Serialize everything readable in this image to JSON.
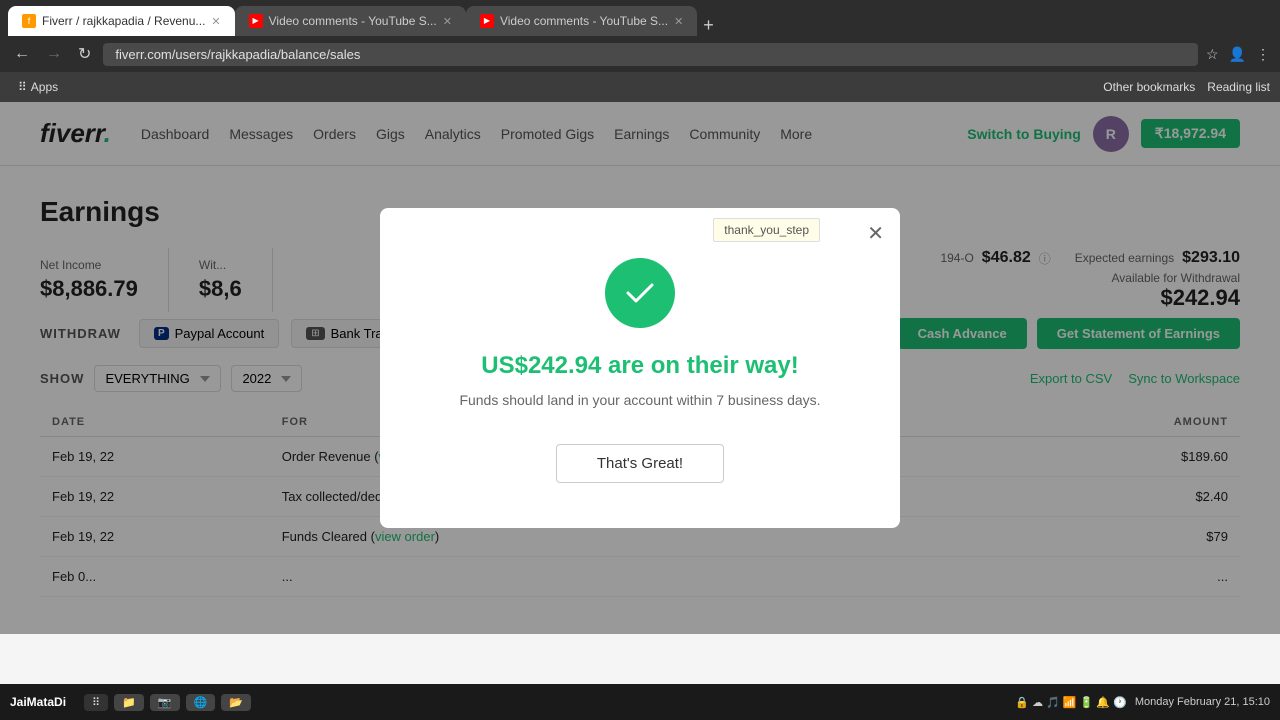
{
  "browser": {
    "tabs": [
      {
        "id": "tab1",
        "favicon_type": "fiverr",
        "label": "Fiverr / rajkkapadia / Revenu...",
        "active": true
      },
      {
        "id": "tab2",
        "favicon_type": "yt",
        "label": "Video comments - YouTube S...",
        "active": false
      },
      {
        "id": "tab3",
        "favicon_type": "yt",
        "label": "Video comments - YouTube S...",
        "active": false
      }
    ],
    "address": "fiverr.com/users/rajkkapadia/balance/sales",
    "bookmarks": [
      {
        "label": "Apps"
      }
    ],
    "bookmarks_right": [
      "Other bookmarks",
      "Reading list"
    ]
  },
  "fiverr_nav": {
    "logo": "fiverr",
    "logo_dot": ".",
    "links": [
      "Dashboard",
      "Messages",
      "Orders",
      "Gigs",
      "Analytics",
      "Promoted Gigs",
      "Earnings",
      "Community",
      "More"
    ],
    "switch_btn": "Switch to Buying",
    "balance": "₹18,972.94"
  },
  "earnings": {
    "title": "Earnings",
    "stats": {
      "net_income_label": "Net Income",
      "net_income_value": "$8,886.79",
      "withdrawn_label": "Wit...",
      "withdrawn_value": "$8,6",
      "available_label": "Available for Withdrawal",
      "available_value": "$242.94",
      "pending_label": "194-O",
      "pending_value": "$46.82",
      "expected_label": "Expected earnings",
      "expected_value": "$293.10"
    },
    "withdraw": {
      "label": "WITHDRAW",
      "paypal_label": "Paypal Account",
      "bank_label": "Bank Transfer",
      "cash_advance_label": "Cash Advance",
      "statement_label": "Get Statement of Earnings"
    },
    "show": {
      "label": "SHOW",
      "select_value": "EVERYTHING",
      "year_value": "2022",
      "export_csv": "Export to CSV",
      "sync_workspace": "Sync to Workspace"
    },
    "table": {
      "headers": [
        "DATE",
        "FOR",
        "AMOUNT"
      ],
      "rows": [
        {
          "date": "Feb 19, 22",
          "for": "Order Revenue (view order)",
          "amount": "$189.60",
          "positive": true
        },
        {
          "date": "Feb 19, 22",
          "for": "Tax collected/deducted at source (view order)",
          "amount": "$2.40",
          "positive": false
        },
        {
          "date": "Feb 19, 22",
          "for": "Funds Cleared (view order)",
          "amount": "$79",
          "positive": false
        },
        {
          "date": "Feb 0...",
          "for": "...",
          "amount": "...",
          "positive": false
        }
      ]
    }
  },
  "modal": {
    "title": "US$242.94 are on their way!",
    "description": "Funds should land in your account within 7 business days.",
    "button_label": "That's Great!",
    "tooltip": "thank_you_step"
  },
  "taskbar": {
    "start_label": "JaiMataDi",
    "items": [],
    "time": "Monday February 21, 15:10"
  }
}
